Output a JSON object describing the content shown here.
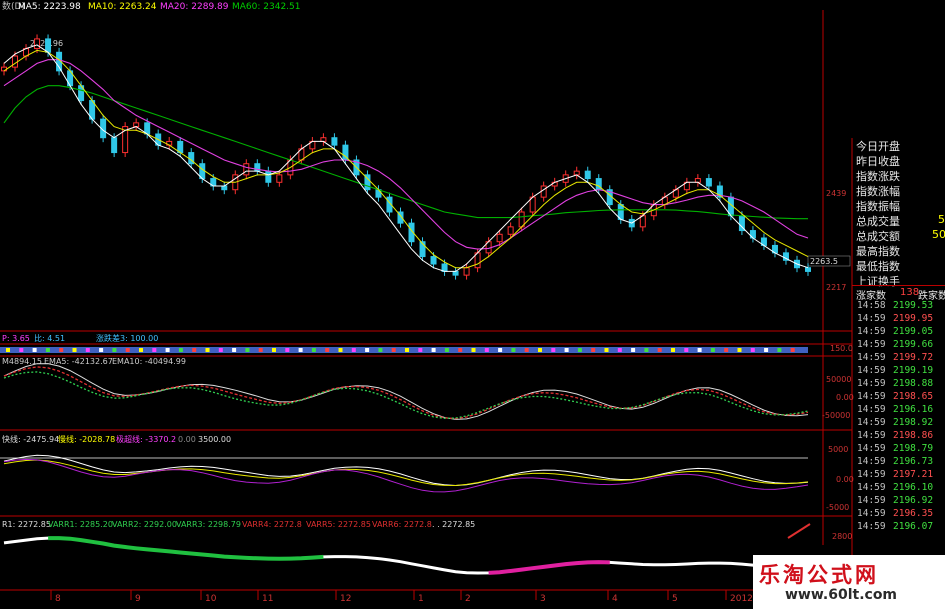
{
  "main_header": {
    "prefix": "数(D)",
    "ma5": "MA5: 2223.98",
    "ma10": "MA10: 2263.24",
    "ma20": "MA20: 2289.89",
    "ma60": "MA60: 2342.51",
    "colors": {
      "ma5": "#ffffff",
      "ma10": "#ffff00",
      "ma20": "#ff40ff",
      "ma60": "#00cc00"
    }
  },
  "panel2_header": {
    "a": "P: 3.65",
    "b": "比: 4.51",
    "c": "涨跌差3: 100.00"
  },
  "panel3_header": {
    "a": "M4894.15",
    "b": "EMA5: -42132.67",
    "c": "EMA10: -40494.99"
  },
  "panel4_header": {
    "a": "快线: -2475.94",
    "b": "慢线: -2028.78",
    "c": "极超线: -3370.2",
    "d": "0.00",
    "e": "3500.00"
  },
  "panel5_header": {
    "a": "R1: 2272.85",
    "b": "VARR1: 2285.20",
    "c": "VARR2: 2292.00",
    "d": "VARR3: 2298.79",
    "e": "VARR4: 2272.8",
    "f": "VARR5: 2272.85",
    "g": "VARR6: 2272.8",
    "h": ". . 2272.85"
  },
  "axis_labels": {
    "p1": [
      "2439",
      "2217",
      "2263.5"
    ],
    "p2": [
      "150.0"
    ],
    "p3": [
      "50000",
      "0.00",
      "-50000"
    ],
    "p4": [
      "5000",
      "0.00",
      "-5000"
    ],
    "p5": [
      "2800"
    ]
  },
  "price_annotations": {
    "high": "2826.96"
  },
  "info_panel": {
    "labels": [
      "今日开盘",
      "昨日收盘",
      "指数涨跌",
      "指数涨幅",
      "指数振幅",
      "总成交量",
      "总成交额",
      "最高指数",
      "最低指数",
      "上证换手"
    ],
    "side_values": [
      "5",
      "50"
    ],
    "counts": {
      "up_label": "涨家数",
      "up_value": "138",
      "down_label": "跌家数"
    }
  },
  "ticks": [
    {
      "time": "14:58",
      "price": "2199.53"
    },
    {
      "time": "14:59",
      "price": "2199.95"
    },
    {
      "time": "14:59",
      "price": "2199.05"
    },
    {
      "time": "14:59",
      "price": "2199.66"
    },
    {
      "time": "14:59",
      "price": "2199.72"
    },
    {
      "time": "14:59",
      "price": "2199.19"
    },
    {
      "time": "14:59",
      "price": "2198.88"
    },
    {
      "time": "14:59",
      "price": "2198.65"
    },
    {
      "time": "14:59",
      "price": "2196.16"
    },
    {
      "time": "14:59",
      "price": "2198.92"
    },
    {
      "time": "14:59",
      "price": "2198.86"
    },
    {
      "time": "14:59",
      "price": "2198.79"
    },
    {
      "time": "14:59",
      "price": "2196.73"
    },
    {
      "time": "14:59",
      "price": "2197.21"
    },
    {
      "time": "14:59",
      "price": "2196.10"
    },
    {
      "time": "14:59",
      "price": "2196.92"
    },
    {
      "time": "14:59",
      "price": "2196.35"
    },
    {
      "time": "14:59",
      "price": "2196.07"
    }
  ],
  "date_axis": [
    "8",
    "9",
    "10",
    "11",
    "12",
    "1",
    "2",
    "3",
    "4",
    "5",
    "2012/0"
  ],
  "watermark": {
    "cn": "乐淘公式网",
    "url": "www.60lt.com"
  },
  "chart_data": {
    "type": "line",
    "title": "",
    "y_range_main": [
      2150,
      2850
    ],
    "candles_close": [
      2750,
      2780,
      2800,
      2826,
      2790,
      2740,
      2700,
      2660,
      2610,
      2560,
      2520,
      2590,
      2600,
      2570,
      2540,
      2550,
      2520,
      2490,
      2450,
      2430,
      2420,
      2460,
      2490,
      2470,
      2440,
      2460,
      2500,
      2530,
      2550,
      2560,
      2540,
      2500,
      2460,
      2420,
      2400,
      2360,
      2330,
      2280,
      2240,
      2220,
      2200,
      2190,
      2210,
      2250,
      2280,
      2300,
      2320,
      2360,
      2400,
      2430,
      2440,
      2460,
      2470,
      2450,
      2420,
      2380,
      2340,
      2320,
      2350,
      2380,
      2400,
      2420,
      2440,
      2450,
      2430,
      2400,
      2350,
      2310,
      2290,
      2270,
      2250,
      2230,
      2210,
      2200
    ],
    "ma5": [
      2760,
      2785,
      2800,
      2810,
      2790,
      2750,
      2700,
      2650,
      2610,
      2580,
      2560,
      2580,
      2590,
      2570,
      2540,
      2530,
      2510,
      2480,
      2450,
      2430,
      2430,
      2450,
      2470,
      2470,
      2460,
      2470,
      2500,
      2530,
      2550,
      2550,
      2530,
      2490,
      2450,
      2410,
      2380,
      2340,
      2300,
      2260,
      2230,
      2210,
      2200,
      2200,
      2220,
      2250,
      2280,
      2310,
      2340,
      2370,
      2400,
      2420,
      2440,
      2450,
      2460,
      2440,
      2410,
      2370,
      2340,
      2330,
      2350,
      2380,
      2400,
      2420,
      2440,
      2440,
      2420,
      2390,
      2350,
      2320,
      2290,
      2270,
      2250,
      2235,
      2220,
      2210
    ],
    "ma10": [
      2740,
      2760,
      2780,
      2795,
      2790,
      2770,
      2740,
      2700,
      2660,
      2620,
      2590,
      2580,
      2580,
      2570,
      2555,
      2540,
      2520,
      2500,
      2475,
      2455,
      2440,
      2440,
      2450,
      2460,
      2460,
      2465,
      2480,
      2500,
      2520,
      2530,
      2530,
      2510,
      2480,
      2450,
      2420,
      2385,
      2350,
      2310,
      2275,
      2245,
      2225,
      2210,
      2210,
      2220,
      2240,
      2265,
      2290,
      2320,
      2350,
      2380,
      2405,
      2425,
      2440,
      2440,
      2430,
      2405,
      2380,
      2360,
      2355,
      2365,
      2380,
      2395,
      2410,
      2420,
      2420,
      2405,
      2380,
      2355,
      2330,
      2305,
      2285,
      2270,
      2255,
      2240
    ],
    "ma20": [
      2700,
      2720,
      2740,
      2760,
      2770,
      2770,
      2760,
      2740,
      2715,
      2690,
      2660,
      2640,
      2620,
      2605,
      2590,
      2575,
      2560,
      2545,
      2530,
      2515,
      2500,
      2490,
      2480,
      2475,
      2470,
      2468,
      2470,
      2475,
      2485,
      2495,
      2500,
      2500,
      2495,
      2485,
      2470,
      2450,
      2425,
      2395,
      2365,
      2335,
      2305,
      2280,
      2265,
      2260,
      2262,
      2272,
      2290,
      2310,
      2330,
      2350,
      2370,
      2390,
      2405,
      2415,
      2420,
      2415,
      2405,
      2395,
      2385,
      2380,
      2380,
      2385,
      2392,
      2400,
      2405,
      2405,
      2400,
      2390,
      2375,
      2360,
      2340,
      2320,
      2300,
      2290
    ],
    "ma60": [
      2600,
      2640,
      2670,
      2690,
      2700,
      2700,
      2695,
      2688,
      2680,
      2670,
      2660,
      2650,
      2640,
      2630,
      2620,
      2610,
      2600,
      2590,
      2580,
      2570,
      2560,
      2550,
      2540,
      2530,
      2520,
      2510,
      2500,
      2490,
      2480,
      2470,
      2460,
      2450,
      2440,
      2430,
      2420,
      2410,
      2400,
      2390,
      2380,
      2370,
      2360,
      2355,
      2350,
      2345,
      2345,
      2345,
      2345,
      2347,
      2350,
      2352,
      2355,
      2358,
      2360,
      2362,
      2364,
      2365,
      2366,
      2366,
      2366,
      2366,
      2366,
      2365,
      2363,
      2361,
      2358,
      2355,
      2352,
      2350,
      2348,
      2346,
      2344,
      2343,
      2342,
      2342
    ]
  }
}
